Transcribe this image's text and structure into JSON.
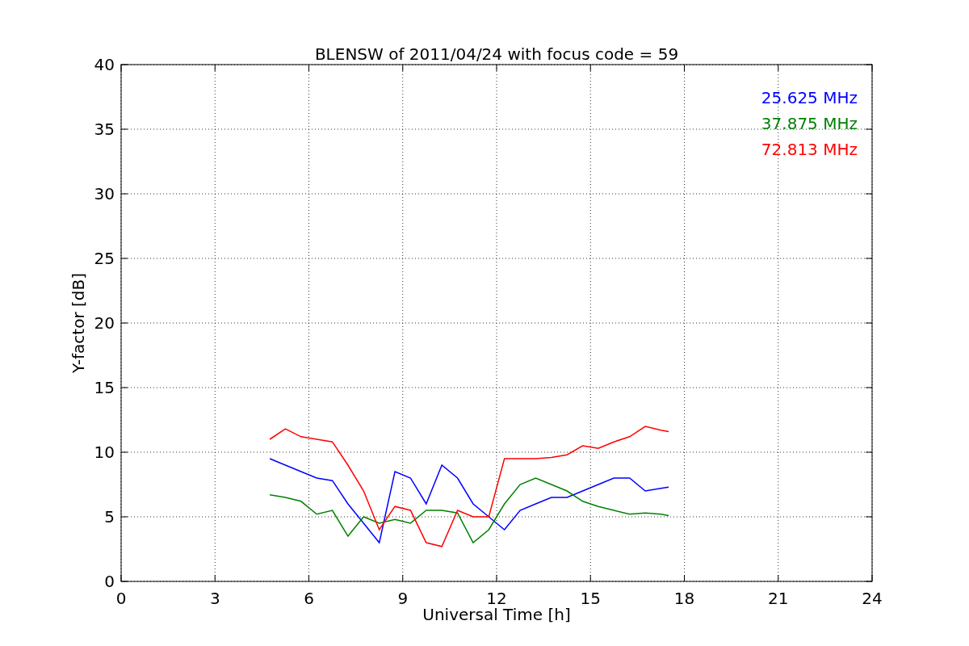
{
  "chart_data": {
    "type": "line",
    "title": "BLENSW of 2011/04/24 with focus code = 59",
    "xlabel": "Universal Time [h]",
    "ylabel": "Y-factor [dB]",
    "x": [
      4.75,
      5.25,
      5.75,
      6.25,
      6.75,
      7.25,
      7.75,
      8.25,
      8.75,
      9.25,
      9.75,
      10.25,
      10.75,
      11.25,
      11.75,
      12.25,
      12.75,
      13.25,
      13.75,
      14.25,
      14.75,
      15.25,
      15.75,
      16.25,
      16.75,
      17.25,
      17.5
    ],
    "series": [
      {
        "name": "25.625 MHz",
        "color": "#0000ff",
        "values": [
          9.5,
          9,
          8.5,
          8,
          7.8,
          6,
          4.5,
          3,
          8.5,
          8,
          6,
          9,
          8,
          6,
          5,
          4,
          5.5,
          6,
          6.5,
          6.5,
          7,
          7.5,
          8,
          8,
          7,
          7.2,
          7.3
        ]
      },
      {
        "name": "37.875 MHz",
        "color": "#008000",
        "values": [
          6.7,
          6.5,
          6.2,
          5.2,
          5.5,
          3.5,
          5,
          4.5,
          4.8,
          4.5,
          5.5,
          5.5,
          5.3,
          3,
          4,
          6,
          7.5,
          8,
          7.5,
          7,
          6.2,
          5.8,
          5.5,
          5.2,
          5.3,
          5.2,
          5.1
        ]
      },
      {
        "name": "72.813 MHz",
        "color": "#ff0000",
        "values": [
          11,
          11.8,
          11.2,
          11,
          10.8,
          9,
          7,
          4,
          5.8,
          5.5,
          3,
          2.7,
          5.5,
          5,
          5,
          9.5,
          9.5,
          9.5,
          9.6,
          9.8,
          10.5,
          10.3,
          10.8,
          11.2,
          12,
          11.7,
          11.6
        ]
      }
    ],
    "xlim": [
      0,
      24
    ],
    "ylim": [
      0,
      40
    ],
    "xticks": [
      0,
      3,
      6,
      9,
      12,
      15,
      18,
      21,
      24
    ],
    "yticks": [
      0,
      5,
      10,
      15,
      20,
      25,
      30,
      35,
      40
    ],
    "grid": true
  }
}
